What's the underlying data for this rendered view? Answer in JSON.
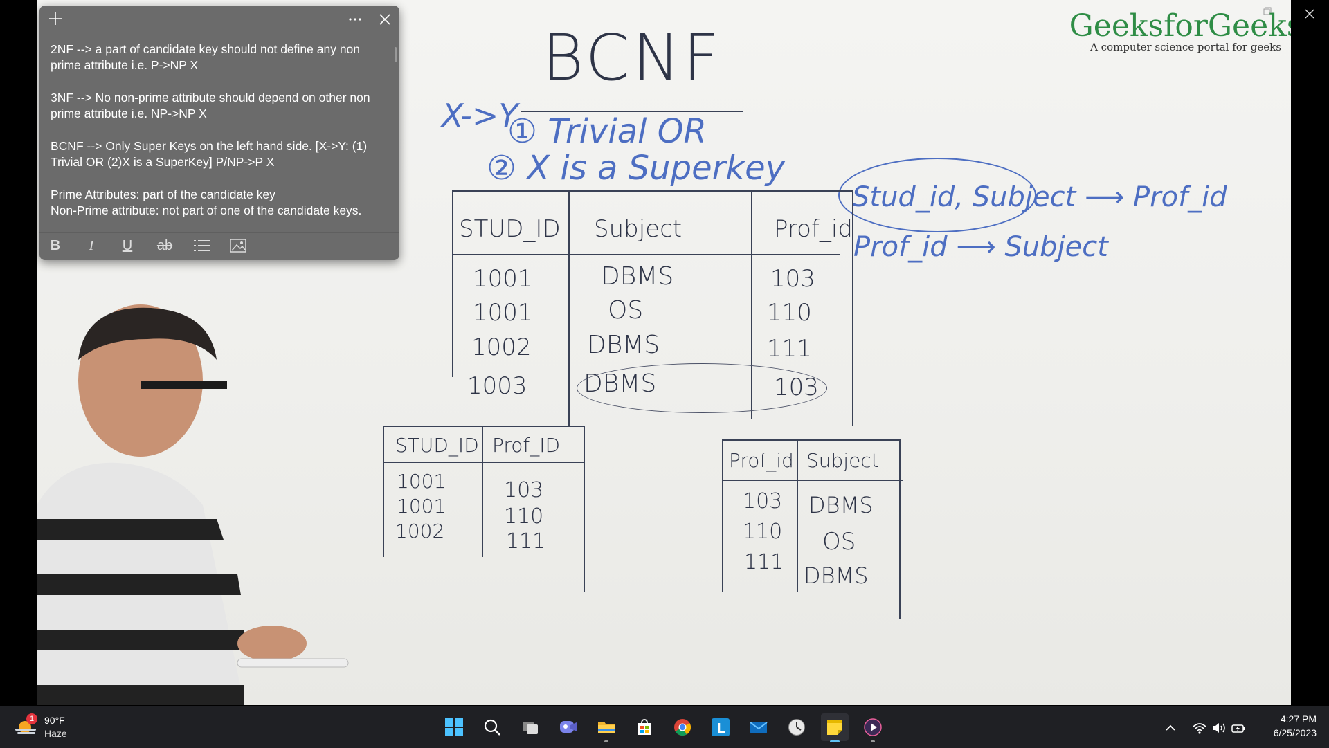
{
  "video": {
    "logo_title": "GeeksforGeeks",
    "logo_subtitle": "A computer science portal for geeks",
    "whiteboard": {
      "heading": "BCNF",
      "rule_lhs": "X->Y",
      "rule_1": "① Trivial  OR",
      "rule_2": "② X is a Superkey",
      "fd_1": "Stud_id, Subject  ⟶  Prof_id",
      "fd_2": "Prof_id  ⟶  Subject",
      "main_table": {
        "headers": [
          "STUD_ID",
          "Subject",
          "Prof_id"
        ],
        "rows": [
          [
            "1001",
            "DBMS",
            "103"
          ],
          [
            "1001",
            "OS",
            "110"
          ],
          [
            "1002",
            "DBMS",
            "111"
          ],
          [
            "1003",
            "DBMS",
            "103"
          ]
        ]
      },
      "table_a": {
        "headers": [
          "STUD_ID",
          "Prof_ID"
        ],
        "rows": [
          [
            "1001",
            "103"
          ],
          [
            "1001",
            "110"
          ],
          [
            "1002",
            "111"
          ]
        ]
      },
      "table_b": {
        "headers": [
          "Prof_id",
          "Subject"
        ],
        "rows": [
          [
            "103",
            "DBMS"
          ],
          [
            "110",
            "OS"
          ],
          [
            "111",
            "DBMS"
          ]
        ]
      }
    }
  },
  "sticky_note": {
    "paragraphs": [
      {
        "line1": "2NF --> a part of  candidate key should not define any non",
        "line2": "prime attribute i.e.  P->NP X"
      },
      {
        "line1": "3NF --> No non-prime attribute should depend on other non",
        "line2": "prime attribute i.e.  NP->NP X"
      },
      {
        "line1": "BCNF --> Only Super Keys on the left  hand side. [X->Y: (1)",
        "line2": "Trivial OR (2)X is a SuperKey] P/NP->P  X"
      },
      {
        "line1": "Prime Attributes: part of the candidate key",
        "line2": "Non-Prime attribute: not part of one of the candidate keys."
      }
    ],
    "toolbar": {
      "bold": "B",
      "italic": "I",
      "underline": "U",
      "strikethrough": "ab"
    }
  },
  "taskbar": {
    "weather": {
      "badge": "1",
      "temperature": "90°F",
      "condition": "Haze"
    },
    "apps": [
      {
        "name": "start",
        "icon": "windows-icon"
      },
      {
        "name": "search",
        "icon": "search-icon"
      },
      {
        "name": "task-view",
        "icon": "task-view-icon"
      },
      {
        "name": "chat",
        "icon": "chat-icon"
      },
      {
        "name": "file-explorer",
        "icon": "folder-icon"
      },
      {
        "name": "store",
        "icon": "store-icon"
      },
      {
        "name": "chrome",
        "icon": "chrome-icon"
      },
      {
        "name": "launcher-l",
        "icon": "letter-l-icon",
        "label": "L"
      },
      {
        "name": "mail",
        "icon": "mail-icon"
      },
      {
        "name": "clock-app",
        "icon": "clock-icon"
      },
      {
        "name": "sticky-notes",
        "icon": "sticky-notes-icon"
      },
      {
        "name": "media-player",
        "icon": "play-icon"
      }
    ],
    "clock": {
      "time": "4:27 PM",
      "date": "6/25/2023"
    },
    "colors": {
      "taskbar_bg": "#1f2024",
      "accent": "#5ec1f3",
      "sticky_bg": "#6b6b6b",
      "gfg_green": "#2f8d46"
    }
  }
}
